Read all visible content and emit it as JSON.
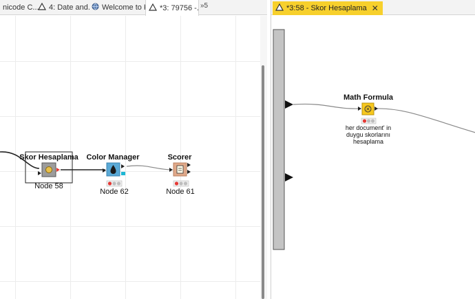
{
  "left_tabs": [
    {
      "label": "nicode C...",
      "icon": "triangle-warning-icon"
    },
    {
      "label": "4: Date and...",
      "icon": "triangle-warning-icon"
    },
    {
      "label": "Welcome to K...",
      "icon": "globe-icon"
    },
    {
      "label": "*3: 79756 -...",
      "icon": "triangle-warning-icon",
      "active": true,
      "close": "✕"
    }
  ],
  "overflow_label": "»5",
  "right_tab": {
    "label": "*3:58 - Skor Hesaplama",
    "icon": "triangle-warning-icon",
    "close": "✕"
  },
  "left_nodes": {
    "skor": {
      "title": "Skor Hesaplama",
      "label": "Node 58"
    },
    "color_manager": {
      "title": "Color Manager",
      "label": "Node 62"
    },
    "scorer": {
      "title": "Scorer",
      "label": "Node 61"
    }
  },
  "right_nodes": {
    "math": {
      "title": "Math Formula",
      "annotation": [
        "her document' in",
        "duygu skorlarını",
        "hesaplama"
      ]
    }
  },
  "colors": {
    "accent": "#f7d02c",
    "metanode": "#9c9c9c",
    "color_manager": "#5aa9d6",
    "scorer": "#e0a98a",
    "math_formula": "#f7c81e",
    "status_red": "#e53935",
    "status_gray": "#bdbdbd"
  }
}
